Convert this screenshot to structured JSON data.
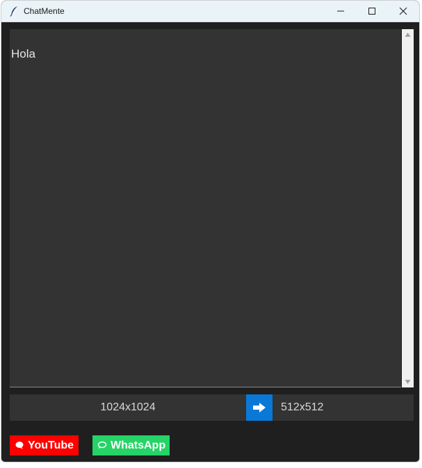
{
  "window": {
    "title": "ChatMente",
    "app_icon": "feather-icon"
  },
  "titlebar_buttons": {
    "minimize_icon": "minimize-icon",
    "maximize_icon": "maximize-icon",
    "close_icon": "close-icon"
  },
  "chat": {
    "text": "Hola"
  },
  "resize": {
    "from_size": "1024x1024",
    "convert_icon": "arrow-right-icon",
    "to_size": "512x512"
  },
  "links": {
    "youtube_label": "YouTube",
    "youtube_icon": "speech-bubble-icon",
    "youtube_color": "#ff0000",
    "whatsapp_label": "WhatsApp",
    "whatsapp_icon": "chat-bubble-icon",
    "whatsapp_color": "#25d366"
  },
  "colors": {
    "window_bg": "#1f1f1f",
    "panel_bg": "#333333",
    "accent": "#0a78d7"
  }
}
